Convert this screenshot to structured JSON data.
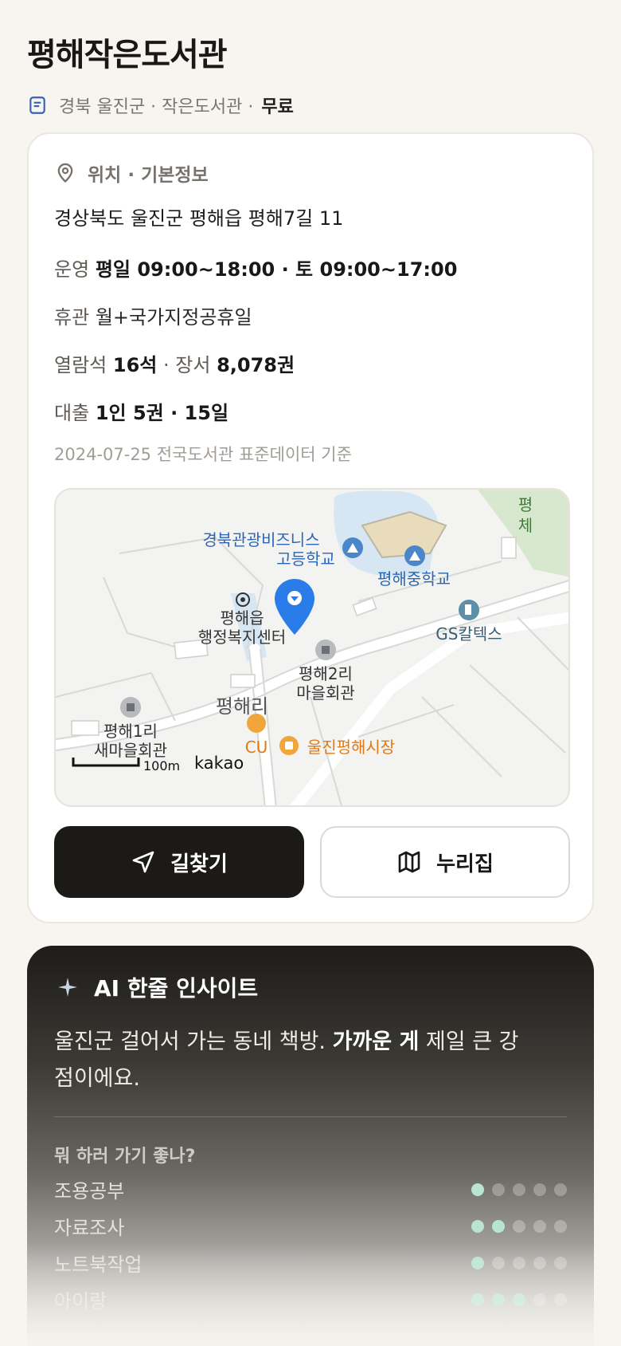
{
  "header": {
    "title": "평해작은도서관",
    "meta": "경북 울진군 · 작은도서관 ·",
    "price": "무료"
  },
  "info": {
    "section_title": "위치 · 기본정보",
    "address": "경상북도 울진군 평해읍 평해7길 11",
    "hours_label": "운영",
    "hours_value": "평일 09:00~18:00 · 토 09:00~17:00",
    "closed_label": "휴관",
    "closed_value": "월+국가지정공휴일",
    "seats_label": "열람석",
    "seats_value": "16석",
    "books_label": "· 장서",
    "books_value": "8,078권",
    "loan_label": "대출",
    "loan_value": "1인 5권 · 15일",
    "source": "2024-07-25 전국도서관 표준데이터 기준"
  },
  "map": {
    "labels": {
      "school_high_1": "경북관광비즈니스",
      "school_high_2": "고등학교",
      "school_middle": "평해중학교",
      "office_1": "평해읍",
      "office_2": "행정복지센터",
      "gas": "GS칼텍스",
      "hall2_1": "평해2리",
      "hall2_2": "마을회관",
      "village": "평해리",
      "hall1_1": "평해1리",
      "hall1_2": "새마을회관",
      "cu": "CU",
      "market": "울진평해시장",
      "edge_1": "평",
      "edge_2": "체",
      "scale": "100m",
      "brand": "kakao"
    }
  },
  "buttons": {
    "directions": "길찾기",
    "nuri": "누리집"
  },
  "ai": {
    "title": "AI 한줄 인사이트",
    "text_prefix": "울진군 걸어서 가는 동네 책방. ",
    "text_bold": "가까운 게",
    "text_suffix": " 제일 큰 강점이에요.",
    "question": "뭐 하러 가기 좋나?",
    "ratings": [
      {
        "name": "조용공부",
        "score": 1
      },
      {
        "name": "자료조사",
        "score": 2
      },
      {
        "name": "노트북작업",
        "score": 1
      },
      {
        "name": "아이랑",
        "score": 3
      }
    ]
  }
}
